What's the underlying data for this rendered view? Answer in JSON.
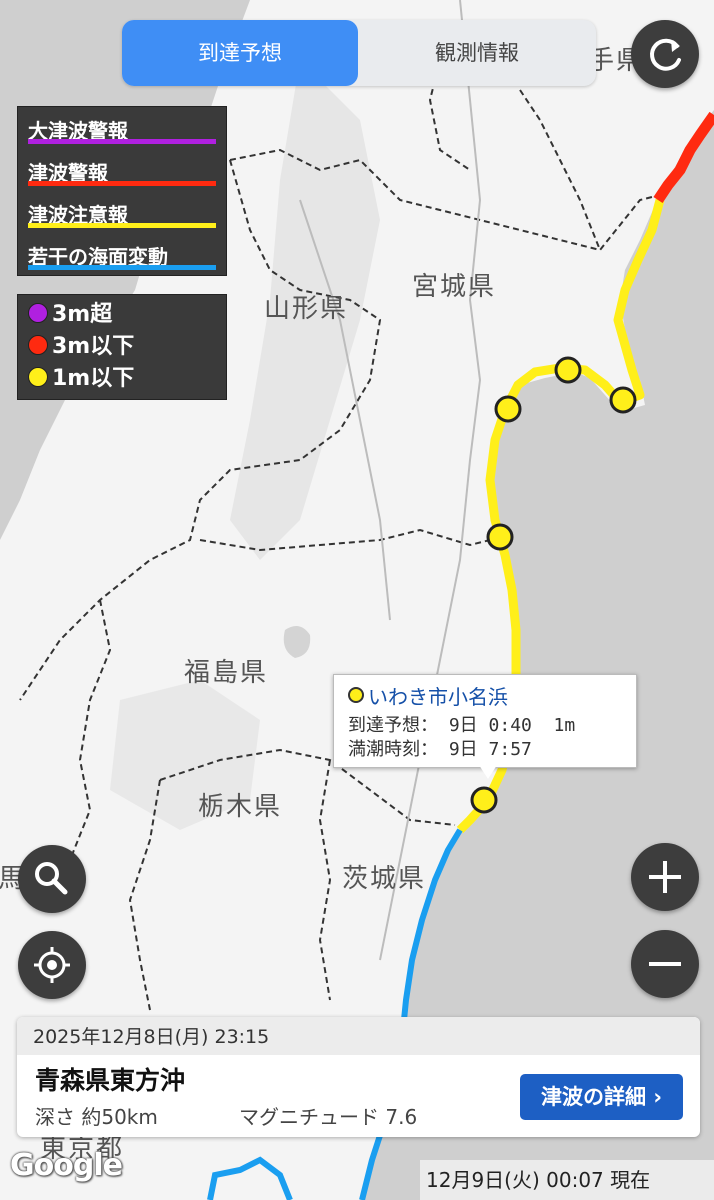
{
  "tabs": [
    {
      "label": "到達予想",
      "active": true
    },
    {
      "label": "観測情報",
      "active": false
    }
  ],
  "buttons": {
    "refresh_icon": "refresh-icon",
    "search_icon": "search-icon",
    "locate_icon": "locate-icon",
    "zoom_in_icon": "plus-icon",
    "zoom_out_icon": "minus-icon"
  },
  "legend": {
    "warnings": [
      {
        "label": "大津波警報",
        "color": "#b020e0"
      },
      {
        "label": "津波警報",
        "color": "#ff2a10"
      },
      {
        "label": "津波注意報",
        "color": "#ffef1a"
      },
      {
        "label": "若干の海面変動",
        "color": "#1a9ef0"
      }
    ],
    "heights": [
      {
        "label": "3m超",
        "color": "#b020e0"
      },
      {
        "label": "3m以下",
        "color": "#ff2a10"
      },
      {
        "label": "1m以下",
        "color": "#ffef1a"
      }
    ]
  },
  "map": {
    "prefectures": [
      "山形県",
      "宮城県",
      "福島県",
      "栃木県",
      "茨城県",
      "手県",
      "群馬県",
      "東京都"
    ],
    "colors": {
      "land": "#f4f4f4",
      "sea": "#cfcfcf",
      "mountain": "#e3e3e3"
    }
  },
  "callout": {
    "location": "いわき市小名浜",
    "arrival_label": "到達予想：",
    "arrival_value": "9日 0:40  1m",
    "high_tide_label": "満潮時刻：",
    "high_tide_value": "9日 7:57"
  },
  "info_card": {
    "datetime": "2025年12月8日(月) 23:15",
    "epicenter": "青森県東方沖",
    "depth": "深さ 約50km",
    "magnitude": "マグニチュード 7.6",
    "detail_button": "津波の詳細"
  },
  "footer": {
    "google": "Google",
    "updated": "12月9日(火) 00:07 現在"
  }
}
